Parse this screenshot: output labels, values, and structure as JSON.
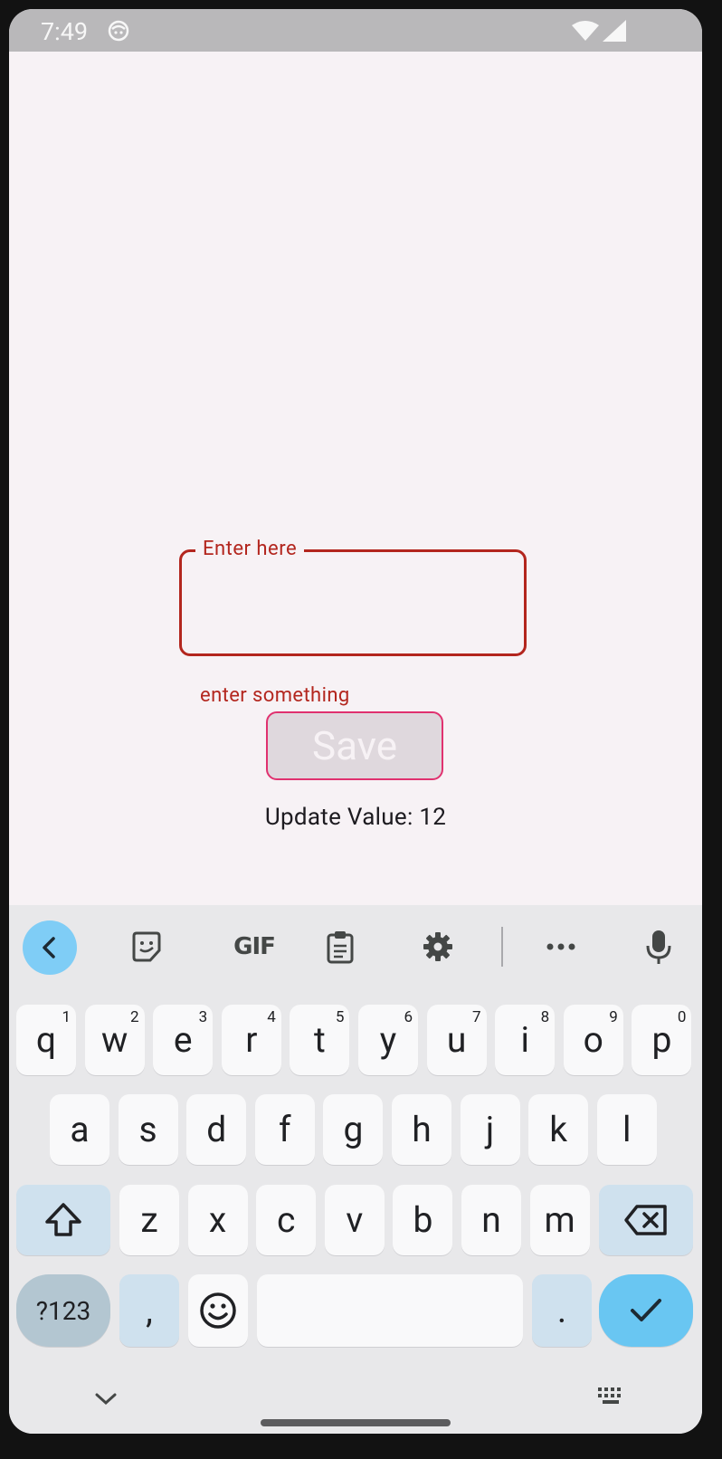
{
  "status_bar": {
    "time": "7:49",
    "icons": [
      "app-notification-icon",
      "wifi-icon",
      "signal-icon"
    ]
  },
  "form": {
    "field_label": "Enter here",
    "field_value": "",
    "error_text": "enter something",
    "save_label": "Save",
    "update_text": "Update Value: 12"
  },
  "keyboard": {
    "toolbar": {
      "items": [
        "back-icon",
        "sticker-icon",
        "gif-icon",
        "clipboard-icon",
        "settings-icon",
        "more-icon",
        "mic-icon"
      ],
      "gif_label": "GIF"
    },
    "rows": [
      [
        {
          "label": "q",
          "num": "1"
        },
        {
          "label": "w",
          "num": "2"
        },
        {
          "label": "e",
          "num": "3"
        },
        {
          "label": "r",
          "num": "4"
        },
        {
          "label": "t",
          "num": "5"
        },
        {
          "label": "y",
          "num": "6"
        },
        {
          "label": "u",
          "num": "7"
        },
        {
          "label": "i",
          "num": "8"
        },
        {
          "label": "o",
          "num": "9"
        },
        {
          "label": "p",
          "num": "0"
        }
      ],
      [
        {
          "label": "a"
        },
        {
          "label": "s"
        },
        {
          "label": "d"
        },
        {
          "label": "f"
        },
        {
          "label": "g"
        },
        {
          "label": "h"
        },
        {
          "label": "j"
        },
        {
          "label": "k"
        },
        {
          "label": "l"
        }
      ],
      [
        {
          "label": "z"
        },
        {
          "label": "x"
        },
        {
          "label": "c"
        },
        {
          "label": "v"
        },
        {
          "label": "b"
        },
        {
          "label": "n"
        },
        {
          "label": "m"
        }
      ]
    ],
    "bottom": {
      "symbols": "?123",
      "comma": ",",
      "period": "."
    }
  },
  "colors": {
    "error": "#b3261e",
    "save_border": "#e0316f",
    "accent": "#69c6f2"
  }
}
